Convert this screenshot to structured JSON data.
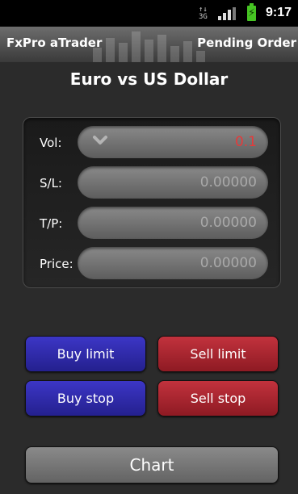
{
  "status": {
    "network": "3G",
    "time": "9:17"
  },
  "header": {
    "app_name": "FxPro aTrader",
    "screen_name": "Pending Order"
  },
  "page": {
    "title": "Euro vs US Dollar"
  },
  "form": {
    "vol": {
      "label": "Vol:",
      "value": "0.1"
    },
    "sl": {
      "label": "S/L:",
      "value": "0.00000"
    },
    "tp": {
      "label": "T/P:",
      "value": "0.00000"
    },
    "price": {
      "label": "Price:",
      "value": "0.00000"
    }
  },
  "actions": {
    "buy_limit": "Buy limit",
    "sell_limit": "Sell limit",
    "buy_stop": "Buy stop",
    "sell_stop": "Sell stop",
    "chart": "Chart"
  },
  "colors": {
    "buy": "#2f2aae",
    "sell": "#ad2630",
    "vol_value": "#e53a3a",
    "battery": "#46c423"
  },
  "icons": {
    "vol_dropdown": "chevron-down-icon",
    "signal": "signal-bars-icon",
    "battery": "battery-charging-icon"
  }
}
